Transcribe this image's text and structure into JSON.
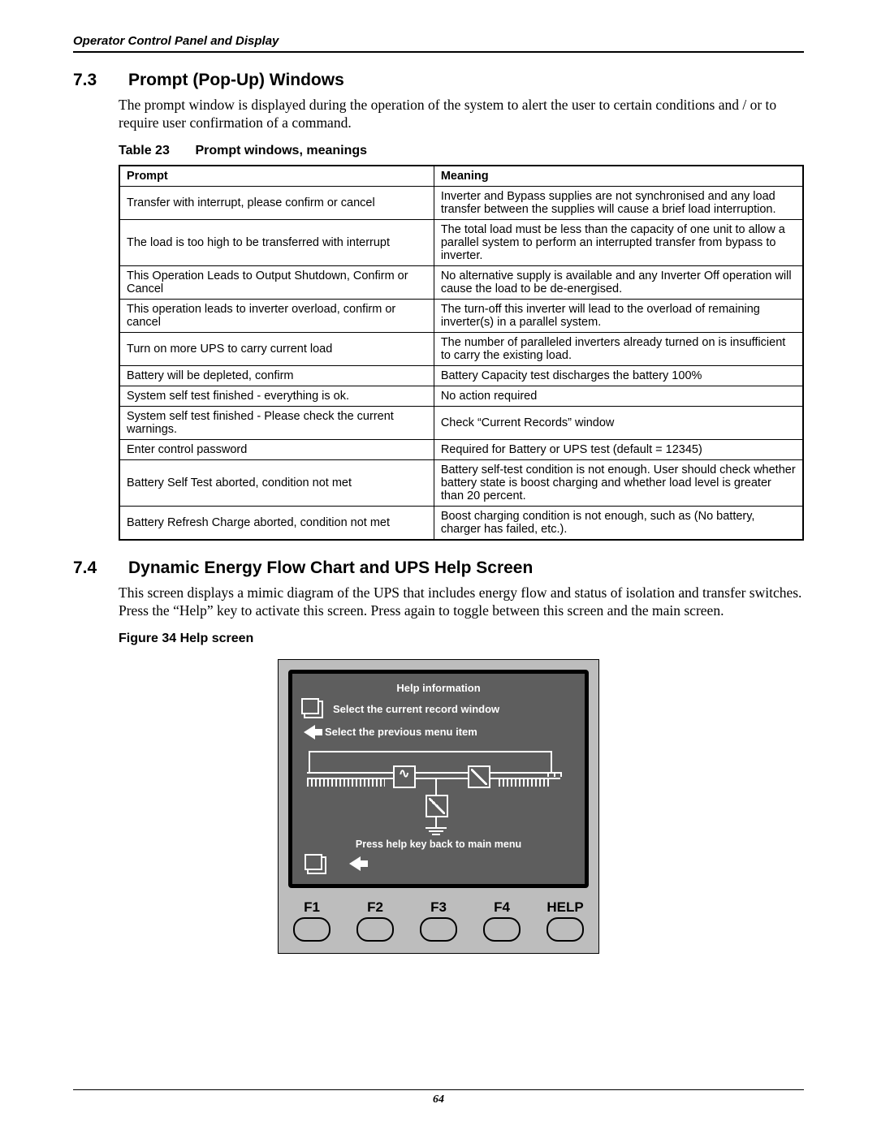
{
  "header": "Operator Control Panel and Display",
  "sec73": {
    "num": "7.3",
    "title": "Prompt (Pop-Up) Windows"
  },
  "para73": "The prompt window is displayed during the operation of the system to alert the user to certain conditions and / or to require user confirmation of a command.",
  "table_caption": {
    "lead": "Table 23",
    "rest": "Prompt windows, meanings"
  },
  "th": {
    "prompt": "Prompt",
    "meaning": "Meaning"
  },
  "rows": [
    {
      "p": "Transfer with interrupt, please confirm or cancel",
      "m": "Inverter and Bypass supplies are not synchronised and any load transfer between the supplies will cause a brief load interruption."
    },
    {
      "p": "The load is too high to be transferred with interrupt",
      "m": "The total load must be less than the capacity of one unit to allow a parallel system to perform an interrupted transfer from bypass to inverter."
    },
    {
      "p": "This Operation Leads to Output Shutdown, Confirm or Cancel",
      "m": "No alternative supply is available and any Inverter Off operation will cause the load to be de-energised."
    },
    {
      "p": "This operation leads to inverter overload, confirm or cancel",
      "m": "The turn-off this inverter will lead to the overload of remaining inverter(s) in a parallel system."
    },
    {
      "p": "Turn on more UPS to carry current load",
      "m": "The number of paralleled inverters already turned on is insufficient to carry the existing load."
    },
    {
      "p": "Battery will be depleted, confirm",
      "m": "Battery Capacity test discharges the battery 100%"
    },
    {
      "p": "System self test finished - everything is ok.",
      "m": "No action required"
    },
    {
      "p": "System self test finished - Please check the current warnings.",
      "m": "Check “Current Records” window"
    },
    {
      "p": "Enter control password",
      "m": "Required for Battery or UPS test (default = 12345)"
    },
    {
      "p": "Battery Self Test aborted, condition not met",
      "m": "Battery self-test condition is not enough. User should check whether battery state is boost charging and whether load level is greater than 20 percent."
    },
    {
      "p": "Battery Refresh Charge aborted, condition not met",
      "m": "Boost charging condition is not enough, such as (No battery, charger has failed, etc.)."
    }
  ],
  "sec74": {
    "num": "7.4",
    "title": "Dynamic Energy Flow Chart and UPS Help Screen"
  },
  "para74": "This screen displays a mimic diagram of the UPS that includes energy flow and status of isolation and transfer switches. Press the “Help” key to activate this screen. Press again to toggle between this screen and the main screen.",
  "fig_caption": "Figure 34  Help screen",
  "help": {
    "title": "Help information",
    "line1": "Select the current record window",
    "line2": "Select the previous menu item",
    "footer": "Press help key back to main menu"
  },
  "buttons": [
    "F1",
    "F2",
    "F3",
    "F4",
    "HELP"
  ],
  "page_number": "64"
}
